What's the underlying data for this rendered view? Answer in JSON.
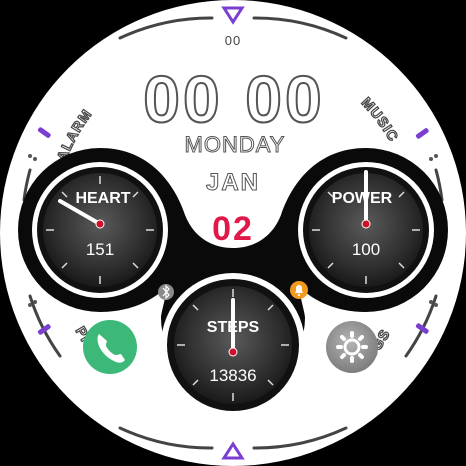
{
  "time": {
    "hours": "00",
    "minutes": "00",
    "seconds": "00"
  },
  "date": {
    "weekday": "MONDAY",
    "month": "JAN",
    "day": "02"
  },
  "ring_labels": {
    "alarm": "ALARM",
    "music": "MUSIC",
    "phone": "PHONE",
    "msgs": "MSGS"
  },
  "gauges": {
    "heart": {
      "label": "HEART",
      "value": "151"
    },
    "power": {
      "label": "POWER",
      "value": "100"
    },
    "steps": {
      "label": "STEPS",
      "value": "13836"
    }
  },
  "icons": {
    "phone": "phone-icon",
    "settings": "gear-icon",
    "bluetooth": "bluetooth-icon",
    "notification": "bell-icon"
  },
  "colors": {
    "accent": "#7a3fd0",
    "date_day": "#e0194a",
    "phone_green": "#3cb878",
    "notification_orange": "#f39a1e",
    "hand_center": "#d0102a"
  }
}
